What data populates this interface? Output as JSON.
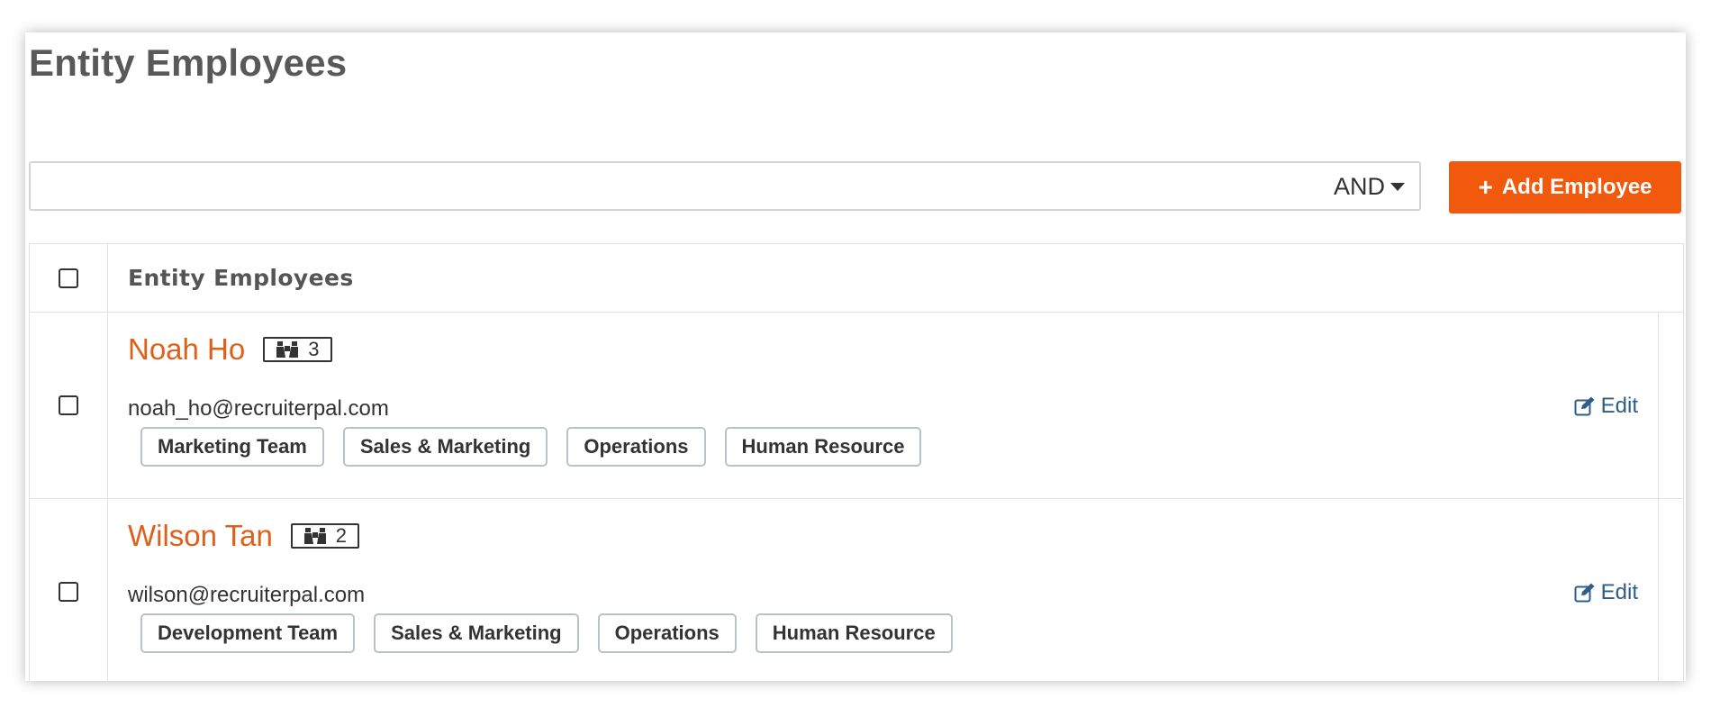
{
  "page": {
    "title": "Entity Employees"
  },
  "search": {
    "value": "",
    "operator": "AND"
  },
  "toolbar": {
    "add_label": "Add Employee"
  },
  "table": {
    "header": "Entity Employees",
    "rows": [
      {
        "name": "Noah Ho",
        "count": "3",
        "email": "noah_ho@recruiterpal.com",
        "tags": [
          "Marketing Team",
          "Sales & Marketing",
          "Operations",
          "Human Resource"
        ],
        "edit_label": "Edit"
      },
      {
        "name": "Wilson Tan",
        "count": "2",
        "email": "wilson@recruiterpal.com",
        "tags": [
          "Development Team",
          "Sales & Marketing",
          "Operations",
          "Human Resource"
        ],
        "edit_label": "Edit"
      }
    ]
  },
  "colors": {
    "accent": "#f15a0d",
    "name_link": "#e0601a",
    "edit_link": "#2e5d87"
  },
  "icons": {
    "add": "plus-icon",
    "operator": "caret-down-icon",
    "count": "binoculars-icon",
    "edit": "edit-icon"
  }
}
